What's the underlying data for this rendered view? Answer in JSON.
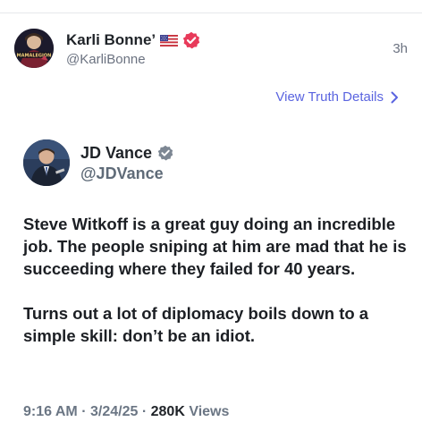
{
  "outer_post": {
    "author_name": "Karli Bonne’",
    "flag_icon": "us-flag-icon",
    "verified_icon": "verified-badge-icon",
    "verified_color": "#e83a5a",
    "handle": "@KarliBonne",
    "time_ago": "3h",
    "avatar_text": "Mamalegion"
  },
  "view_details": {
    "label": "View Truth Details",
    "color": "#5a64e0",
    "icon": "chevron-right-icon"
  },
  "embedded_post": {
    "author_name": "JD Vance",
    "verified_icon": "verified-badge-icon",
    "verified_color": "#7d8793",
    "handle": "@JDVance",
    "paragraphs": [
      "Steve Witkoff is a great guy doing an incredible job. The people sniping at him are mad that he is succeeding where they failed for 40 years.",
      "Turns out a lot of diplomacy boils down to a simple skill: don’t be an idiot."
    ],
    "meta": {
      "time": "9:16 AM",
      "date": "3/24/25",
      "separator": "·",
      "views_count": "280K",
      "views_label": "Views"
    }
  }
}
